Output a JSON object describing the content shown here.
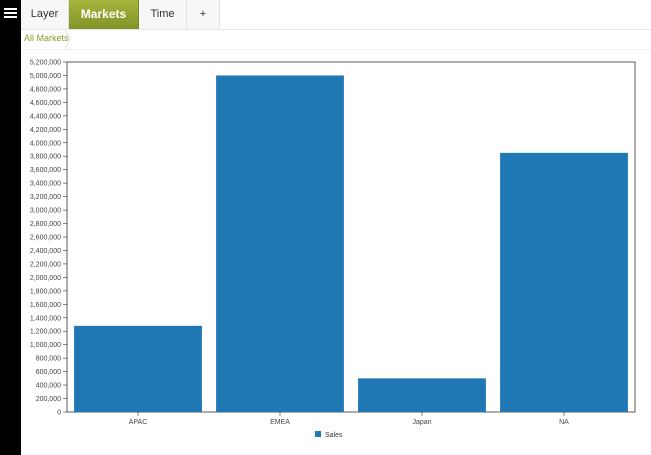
{
  "tabs": [
    {
      "label": "Layer",
      "active": false
    },
    {
      "label": "Markets",
      "active": true
    },
    {
      "label": "Time",
      "active": false
    },
    {
      "label": "+",
      "active": false
    }
  ],
  "breadcrumb": {
    "label": "All Markets"
  },
  "colors": {
    "bar": "#1f77b4",
    "accent": "#8f9e2c"
  },
  "chart_data": {
    "type": "bar",
    "categories": [
      "APAC",
      "EMEA",
      "Japan",
      "NA"
    ],
    "series": [
      {
        "name": "Sales",
        "values": [
          1280000,
          5000000,
          500000,
          3850000
        ]
      }
    ],
    "ylim": [
      0,
      5200000
    ],
    "yticks": [
      "0",
      "200,000",
      "400,000",
      "600,000",
      "800,000",
      "1,000,000",
      "1,200,000",
      "1,400,000",
      "1,600,000",
      "1,800,000",
      "2,000,000",
      "2,200,000",
      "2,400,000",
      "2,600,000",
      "2,800,000",
      "3,000,000",
      "3,200,000",
      "3,400,000",
      "3,600,000",
      "3,800,000",
      "4,000,000",
      "4,200,000",
      "4,400,000",
      "4,600,000",
      "4,800,000",
      "5,000,000",
      "5,200,000"
    ],
    "legend_position": "bottom-center",
    "grid": false
  }
}
